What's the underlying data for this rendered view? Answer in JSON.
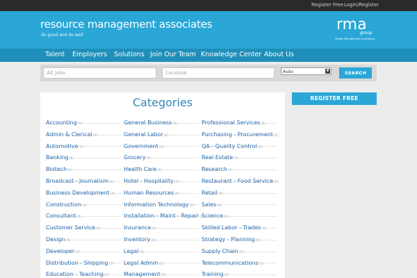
{
  "topbar": {
    "register": "Register Free",
    "login": "Login/Register"
  },
  "header": {
    "brand": "resource management associates",
    "tagline": "do good and do well",
    "logo_text": "rma",
    "logo_sub": "group",
    "logo_caption": "People Management Consulting"
  },
  "nav": [
    {
      "label": "Talent"
    },
    {
      "label": "Employers"
    },
    {
      "label": "Solutions"
    },
    {
      "label": "Join Our Team"
    },
    {
      "label": "Knowledge Center"
    },
    {
      "label": "About Us"
    }
  ],
  "search": {
    "jobs_placeholder": "All Jobs",
    "location_placeholder": "Location",
    "select_value": "Auto",
    "button": "SEARCH"
  },
  "categories": {
    "title": "Categories",
    "columns": [
      [
        {
          "name": "Accounting",
          "count": "(8)"
        },
        {
          "name": "Admin & Clerical",
          "count": "(8)"
        },
        {
          "name": "Automotive",
          "count": "(8)"
        },
        {
          "name": "Banking",
          "count": "(8)"
        },
        {
          "name": "Biotech",
          "count": "(8)"
        },
        {
          "name": "Broadcast - Journalism",
          "count": "(8)"
        },
        {
          "name": "Business Development",
          "count": "(8)"
        },
        {
          "name": "Construction",
          "count": "(8)"
        },
        {
          "name": "Consultant",
          "count": "(8)"
        },
        {
          "name": "Customer Service",
          "count": "(8)"
        },
        {
          "name": "Design",
          "count": "(8)"
        },
        {
          "name": "Developer",
          "count": "(8)"
        },
        {
          "name": "Distribution - Shipping",
          "count": "(8)"
        },
        {
          "name": "Education - Teaching",
          "count": "(8)"
        }
      ],
      [
        {
          "name": "General Business",
          "count": "(8)"
        },
        {
          "name": "General Labor",
          "count": "(8)"
        },
        {
          "name": "Government",
          "count": "(8)"
        },
        {
          "name": "Grocery",
          "count": "(8)"
        },
        {
          "name": "Health Care",
          "count": "(8)"
        },
        {
          "name": "Hotel - Hospitality",
          "count": "(8)"
        },
        {
          "name": "Human Resources",
          "count": "(8)"
        },
        {
          "name": "Information Technology",
          "count": "(8)"
        },
        {
          "name": "Installation - Maint - Repair",
          "count": "(8)"
        },
        {
          "name": "Insurance",
          "count": "(8)"
        },
        {
          "name": "Inventory",
          "count": "(8)"
        },
        {
          "name": "Legal",
          "count": "(8)"
        },
        {
          "name": "Legal Admin",
          "count": "(8)"
        },
        {
          "name": "Management",
          "count": "(8)"
        }
      ],
      [
        {
          "name": "Professional Services",
          "count": "(8)"
        },
        {
          "name": "Purchasing - Procurement",
          "count": "(8)"
        },
        {
          "name": "QA - Quality Control",
          "count": "(8)"
        },
        {
          "name": "Real Estate",
          "count": "(8)"
        },
        {
          "name": "Research",
          "count": "(8)"
        },
        {
          "name": "Restaurant - Food Service",
          "count": "(8)"
        },
        {
          "name": "Retail",
          "count": "(8)"
        },
        {
          "name": "Sales",
          "count": "(8)"
        },
        {
          "name": "Science",
          "count": "(8)"
        },
        {
          "name": "Skilled Labor - Trades",
          "count": "(8)"
        },
        {
          "name": "Strategy - Planning",
          "count": "(8)"
        },
        {
          "name": "Supply Chain",
          "count": "(8)"
        },
        {
          "name": "Telecommunications",
          "count": "(8)"
        },
        {
          "name": "Training",
          "count": "(8)"
        }
      ]
    ]
  },
  "sidebar": {
    "register_button": "REGISTER FREE"
  },
  "colors": {
    "header": "#2aa7d7",
    "nav": "#1f8fba",
    "topbar": "#2a2a2a",
    "link": "#2a6db0",
    "title": "#2f88b7"
  }
}
